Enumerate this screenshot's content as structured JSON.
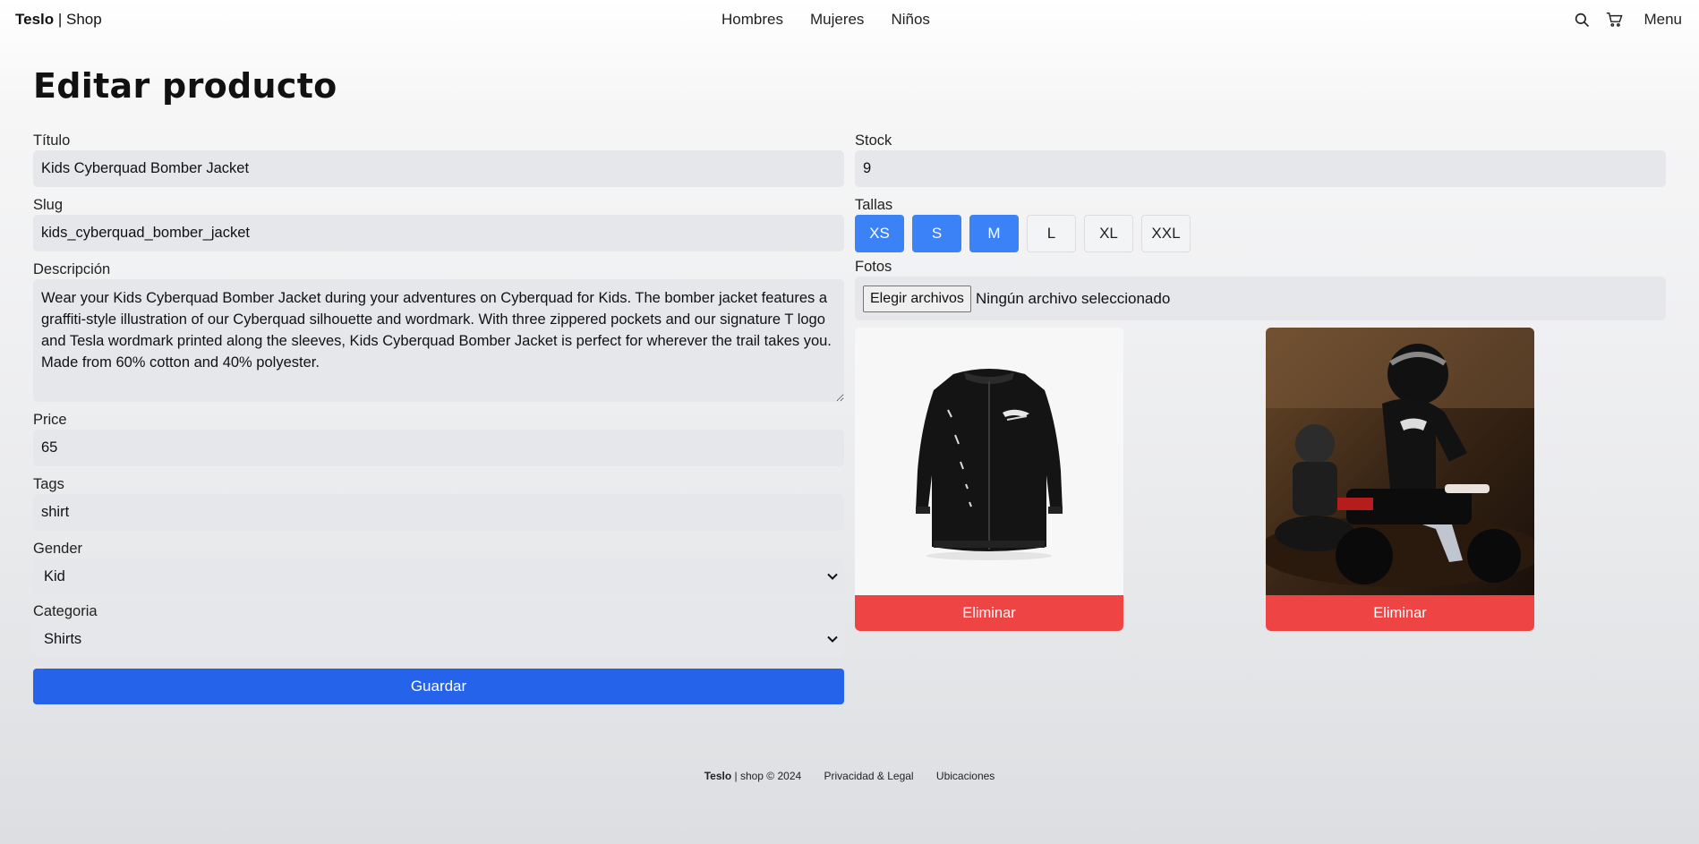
{
  "header": {
    "brand_bold": "Teslo",
    "brand_rest": " | Shop",
    "nav": [
      "Hombres",
      "Mujeres",
      "Niños"
    ],
    "menu_label": "Menu",
    "icons": [
      "search-icon",
      "cart-icon"
    ]
  },
  "page": {
    "title": "Editar producto"
  },
  "form": {
    "title_label": "Título",
    "title_value": "Kids Cyberquad Bomber Jacket",
    "slug_label": "Slug",
    "slug_value": "kids_cyberquad_bomber_jacket",
    "description_label": "Descripción",
    "description_value": "Wear your Kids Cyberquad Bomber Jacket during your adventures on Cyberquad for Kids. The bomber jacket features a graffiti-style illustration of our Cyberquad silhouette and wordmark. With three zippered pockets and our signature T logo and Tesla wordmark printed along the sleeves, Kids Cyberquad Bomber Jacket is perfect for wherever the trail takes you. Made from 60% cotton and 40% polyester.",
    "price_label": "Price",
    "price_value": "65",
    "tags_label": "Tags",
    "tags_value": "shirt",
    "gender_label": "Gender",
    "gender_value": "Kid",
    "category_label": "Categoria",
    "category_value": "Shirts",
    "save_label": "Guardar",
    "stock_label": "Stock",
    "stock_value": "9",
    "sizes_label": "Tallas",
    "sizes": [
      {
        "label": "XS",
        "active": true
      },
      {
        "label": "S",
        "active": true
      },
      {
        "label": "M",
        "active": true
      },
      {
        "label": "L",
        "active": false
      },
      {
        "label": "XL",
        "active": false
      },
      {
        "label": "XXL",
        "active": false
      }
    ],
    "photos_label": "Fotos",
    "file_button": "Elegir archivos",
    "file_status": "Ningún archivo seleccionado",
    "delete_label": "Eliminar"
  },
  "colors": {
    "primary": "#2563eb",
    "size_active": "#3b82f6",
    "danger": "#ef4444",
    "input_bg": "#e5e7eb"
  },
  "footer": {
    "brand_bold": "Teslo",
    "brand_rest": " | shop © 2024",
    "links": [
      "Privacidad & Legal",
      "Ubicaciones"
    ]
  }
}
